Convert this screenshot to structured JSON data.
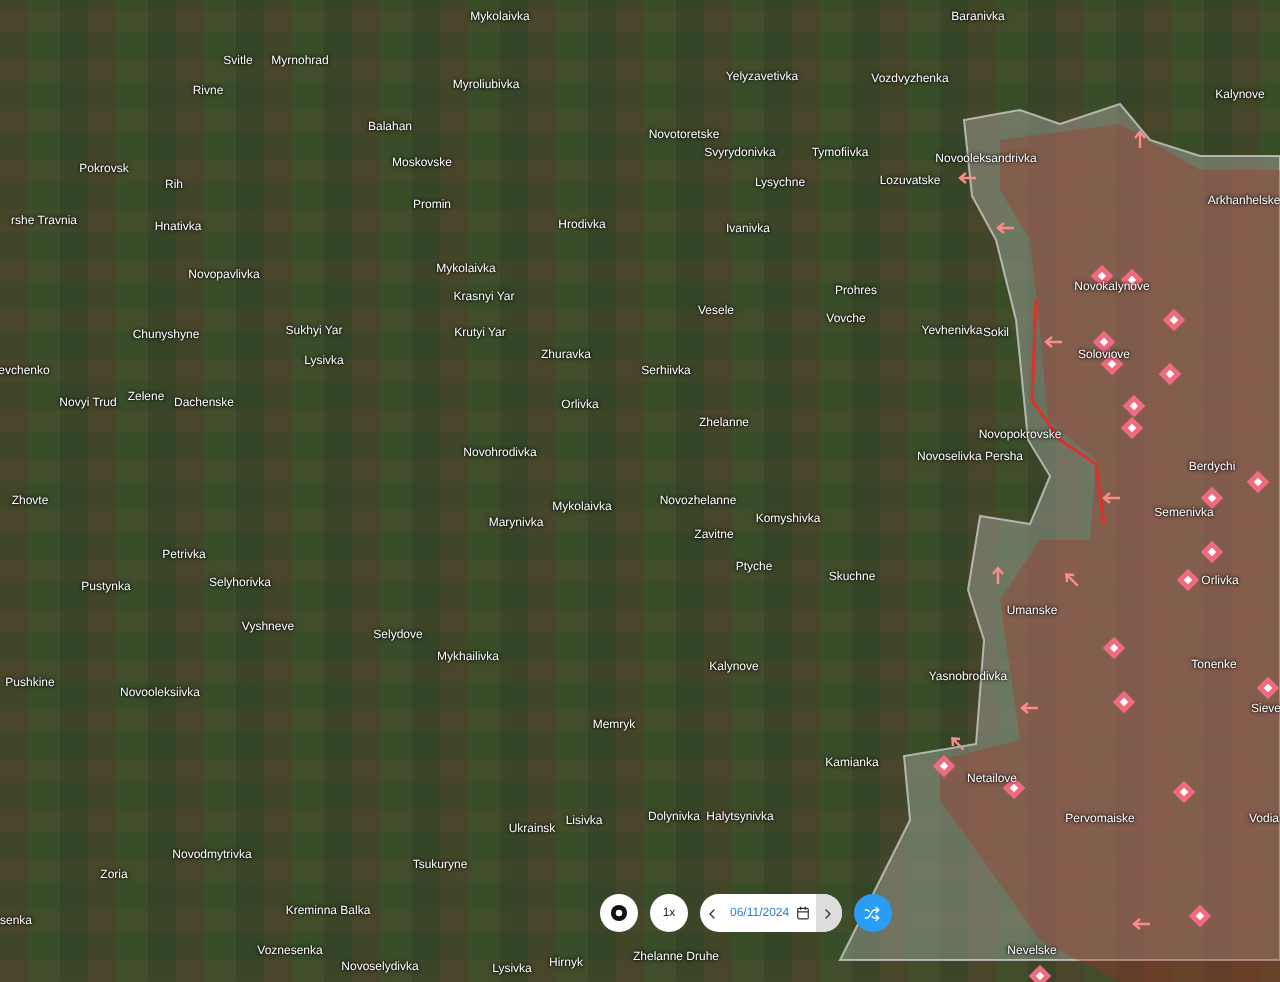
{
  "map": {
    "place_labels": [
      "Svitle",
      "Myrnohrad",
      "Rivne",
      "Balahan",
      "Pokrovsk",
      "Rih",
      "Moskovske",
      "Promin",
      "rshe Travnia",
      "Hnativka",
      "Novopavlivka",
      "Chunyshyne",
      "Sukhyi Yar",
      "Lysivka",
      "evchenko",
      "Novyi Trud",
      "Zelene",
      "Dachenske",
      "Mykolaivka",
      "Myroliubivka",
      "Yelyzavetivka",
      "Novotoretske",
      "Svyrydonivka",
      "Tymofiivka",
      "Lysychne",
      "Ivanivka",
      "Hrodivka",
      "Mykolaivka",
      "Krasnyi Yar",
      "Krutyi Yar",
      "Zhuravka",
      "Orlivka",
      "Serhiivka",
      "Vesele",
      "Zhelanne",
      "Novohrodivka",
      "Baranivka",
      "Vozdvyzhenka",
      "Kalynove",
      "Novooleksandrivka",
      "Lozuvatske",
      "Arkhanhelske",
      "Prohres",
      "Vovche",
      "Yevhenivka",
      "Sokil",
      "Novokalynove",
      "Soloviove",
      "Novopokrovske",
      "Novoselivka Persha",
      "Berdychi",
      "Semenivka",
      "Orlivka",
      "Umanske",
      "Tonenke",
      "Sieve",
      "Yasnobrodivka",
      "Netailove",
      "Pervomaiske",
      "Vodia",
      "Nevelske",
      "Skuchne",
      "Kamianka",
      "Kalynove",
      "Zhovte",
      "Petrivka",
      "Pustynka",
      "Selyhorivka",
      "Vyshneve",
      "Selydove",
      "Pushkine",
      "Novooleksiivka",
      "Novodmytrivka",
      "Zoria",
      "Kreminna Balka",
      "Voznesenka",
      "Novoselydivka",
      "senka",
      "Marynivka",
      "Mykolaivka",
      "Novozhelanne",
      "Komyshivka",
      "Zavitne",
      "Ptyche",
      "Mykhailivka",
      "Memryk",
      "Lisivka",
      "Ukrainsk",
      "Dolynivka",
      "Halytsynivka",
      "Tsukuryne",
      "Lysivka",
      "Hirnyk",
      "Zhelanne Druhe"
    ]
  },
  "controls": {
    "speed": "1x",
    "date": "06/11/2024"
  }
}
